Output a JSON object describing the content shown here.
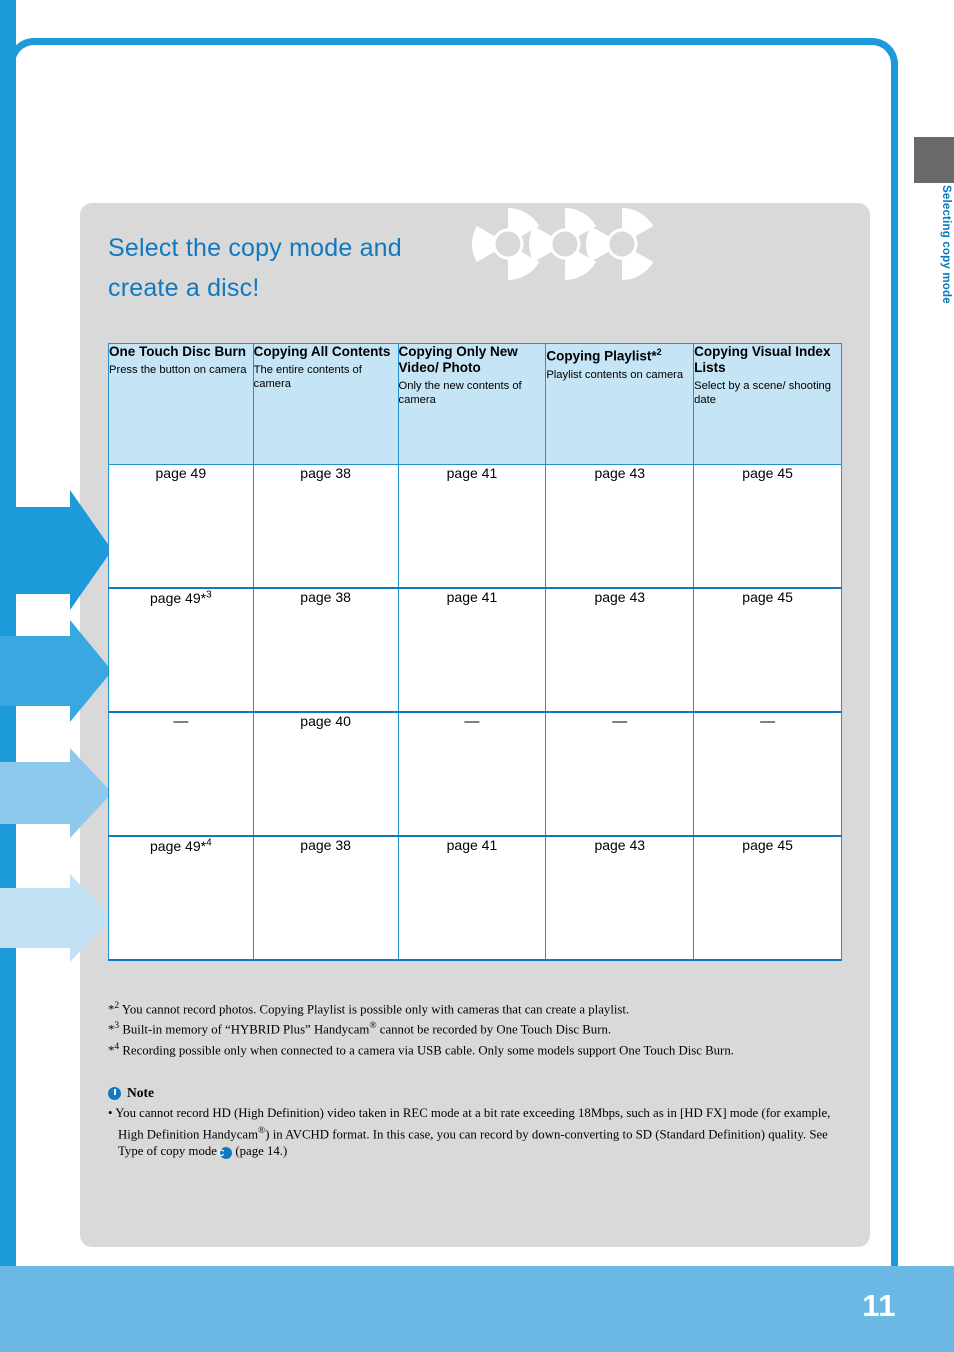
{
  "page": {
    "number": "11",
    "side_tab_label": "Selecting copy mode"
  },
  "title": {
    "line1": "Select the copy mode and",
    "line2": "create a disc!"
  },
  "table": {
    "columns": [
      {
        "title": "One Touch Disc Burn",
        "sub": "Press the button on camera"
      },
      {
        "title": "Copying All Contents",
        "sub": "The entire contents of camera"
      },
      {
        "title": "Copying Only New Video/ Photo",
        "sub": "Only the new contents of camera"
      },
      {
        "title": "Copying Playlist*2",
        "sub": "Playlist contents on camera"
      },
      {
        "title": "Copying Visual Index Lists",
        "sub": "Select by a scene/ shooting date"
      }
    ],
    "rows": [
      {
        "cells": [
          "page 49",
          "page 38",
          "page 41",
          "page 43",
          "page 45"
        ]
      },
      {
        "cells": [
          "page 49*3",
          "page 38",
          "page 41",
          "page 43",
          "page 45"
        ]
      },
      {
        "cells": [
          "—",
          "page 40",
          "—",
          "—",
          "—"
        ]
      },
      {
        "cells": [
          "page 49*4",
          "page 38",
          "page 41",
          "page 43",
          "page 45"
        ]
      }
    ]
  },
  "footnotes": [
    "*2 You cannot record photos. Copying Playlist is possible only with cameras that can create a playlist.",
    "*3 Built-in memory of “HYBRID Plus” Handycam® cannot be recorded by One Touch Disc Burn.",
    "*4 Recording possible only when connected to a camera via USB cable. Only some models support One Touch Disc Burn."
  ],
  "note": {
    "title": "Note",
    "body": "• You cannot record HD (High Definition) video taken in REC mode at a bit rate exceeding 18Mbps, such as in [HD FX] mode (for example, High Definition Handycam®) in AVCHD format. In this case, you can record by down-converting to SD (Standard Definition) quality. See Type of copy mode C (page 14.)"
  }
}
